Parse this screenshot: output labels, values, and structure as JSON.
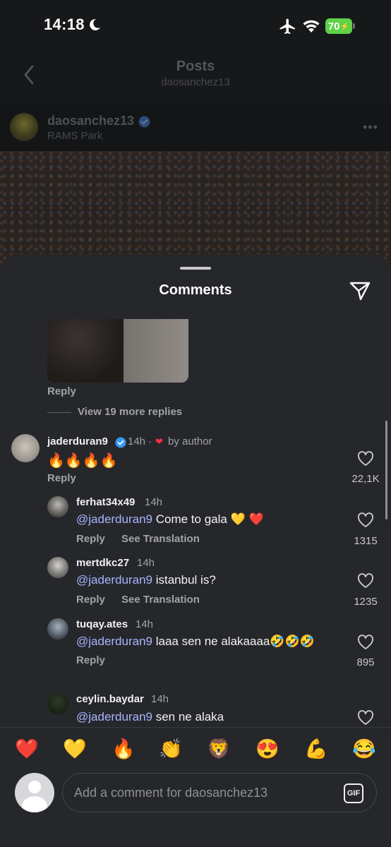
{
  "status_bar": {
    "time": "14:18",
    "battery": "70"
  },
  "top_nav": {
    "title": "Posts",
    "subtitle": "daosanchez13"
  },
  "post": {
    "username": "daosanchez13",
    "location": "RAMS Park",
    "more": "•••"
  },
  "sheet": {
    "title": "Comments"
  },
  "labels": {
    "reply": "Reply",
    "see_translation": "See Translation",
    "view_more": "View 19 more replies"
  },
  "comments": [
    {
      "username": "jaderduran9",
      "time": "14h",
      "by_author": "by author",
      "separator": "·",
      "text": "🔥🔥🔥🔥",
      "likes": "22,1K"
    },
    {
      "username": "ferhat34x49",
      "time": "14h",
      "mention": "@jaderduran9",
      "text": " Come to gala 💛 ❤️",
      "likes": "1315"
    },
    {
      "username": "mertdkc27",
      "time": "14h",
      "mention": "@jaderduran9",
      "text": " istanbul is?",
      "likes": "1235"
    },
    {
      "username": "tuqay.ates",
      "time": "14h",
      "mention": "@jaderduran9",
      "text": " laaa sen ne alakaaaa🤣🤣🤣",
      "likes": "895"
    },
    {
      "username": "ceylin.baydar",
      "time": "14h",
      "mention": "@jaderduran9",
      "text": " sen ne alaka"
    }
  ],
  "emojis": [
    "❤️",
    "💛",
    "🔥",
    "👏",
    "🦁",
    "😍",
    "💪",
    "😂"
  ],
  "composer": {
    "placeholder": "Add a comment for daosanchez13",
    "gif": "GIF"
  },
  "colors": {
    "mention": "#a8b5ff",
    "battery": "#5ed24a",
    "sheet": "#26272b"
  }
}
